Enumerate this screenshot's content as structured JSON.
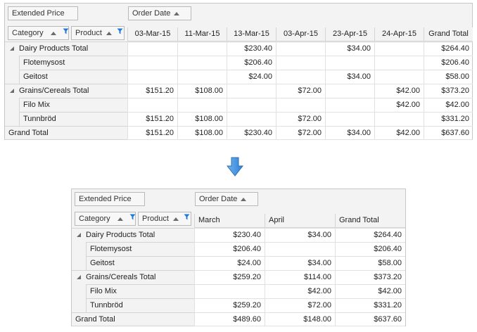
{
  "colors": {
    "header_bg": "#f3f3f3",
    "border": "#c7c7c7",
    "arrow_fill": "#3d8fe0",
    "arrow_stroke": "#2a6fb5",
    "icon_blue": "#1f7ad6"
  },
  "top_grid": {
    "data_field": "Extended Price",
    "column_field": "Order Date",
    "row_fields": [
      "Category",
      "Product"
    ],
    "columns": [
      "03-Mar-15",
      "11-Mar-15",
      "13-Mar-15",
      "03-Apr-15",
      "23-Apr-15",
      "24-Apr-15",
      "Grand Total"
    ],
    "rows": [
      {
        "label": "Dairy Products Total",
        "type": "total",
        "values": [
          "",
          "",
          "$230.40",
          "",
          "$34.00",
          "",
          "$264.40"
        ]
      },
      {
        "label": "Flotemysost",
        "type": "child",
        "values": [
          "",
          "",
          "$206.40",
          "",
          "",
          "",
          "$206.40"
        ]
      },
      {
        "label": "Geitost",
        "type": "child",
        "values": [
          "",
          "",
          "$24.00",
          "",
          "$34.00",
          "",
          "$58.00"
        ]
      },
      {
        "label": "Grains/Cereals Total",
        "type": "total",
        "values": [
          "$151.20",
          "$108.00",
          "",
          "$72.00",
          "",
          "$42.00",
          "$373.20"
        ]
      },
      {
        "label": "Filo Mix",
        "type": "child",
        "values": [
          "",
          "",
          "",
          "",
          "",
          "$42.00",
          "$42.00"
        ]
      },
      {
        "label": "Tunnbröd",
        "type": "child",
        "values": [
          "$151.20",
          "$108.00",
          "",
          "$72.00",
          "",
          "",
          "$331.20"
        ]
      },
      {
        "label": "Grand Total",
        "type": "grand",
        "values": [
          "$151.20",
          "$108.00",
          "$230.40",
          "$72.00",
          "$34.00",
          "$42.00",
          "$637.60"
        ]
      }
    ]
  },
  "bottom_grid": {
    "data_field": "Extended Price",
    "column_field": "Order Date",
    "row_fields": [
      "Category",
      "Product"
    ],
    "columns": [
      "March",
      "April",
      "Grand Total"
    ],
    "rows": [
      {
        "label": "Dairy Products Total",
        "type": "total",
        "values": [
          "$230.40",
          "$34.00",
          "$264.40"
        ]
      },
      {
        "label": "Flotemysost",
        "type": "child",
        "values": [
          "$206.40",
          "",
          "$206.40"
        ]
      },
      {
        "label": "Geitost",
        "type": "child",
        "values": [
          "$24.00",
          "$34.00",
          "$58.00"
        ]
      },
      {
        "label": "Grains/Cereals Total",
        "type": "total",
        "values": [
          "$259.20",
          "$114.00",
          "$373.20"
        ]
      },
      {
        "label": "Filo Mix",
        "type": "child",
        "values": [
          "",
          "$42.00",
          "$42.00"
        ]
      },
      {
        "label": "Tunnbröd",
        "type": "child",
        "values": [
          "$259.20",
          "$72.00",
          "$331.20"
        ]
      },
      {
        "label": "Grand Total",
        "type": "grand",
        "values": [
          "$489.60",
          "$148.00",
          "$637.60"
        ]
      }
    ]
  }
}
